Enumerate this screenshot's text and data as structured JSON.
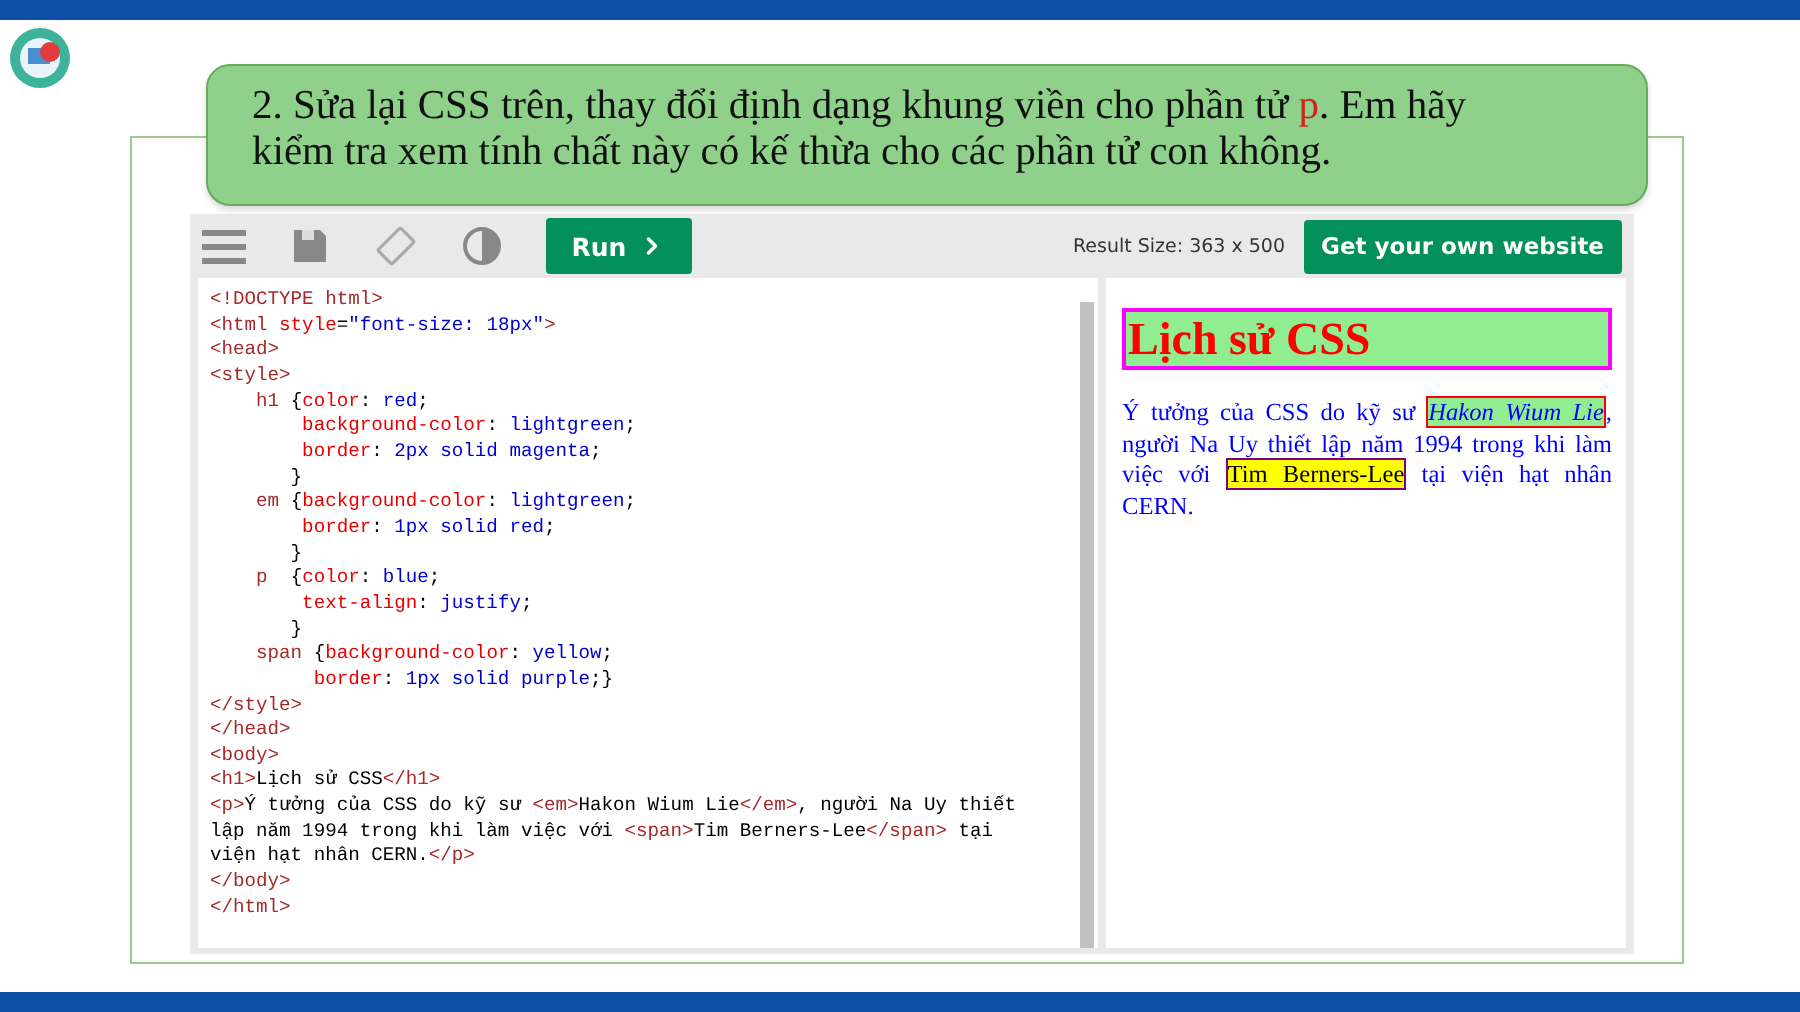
{
  "prompt": [
    {
      "kind": "text",
      "text": "2. Sửa lại CSS trên, thay đổi định dạng khung viền cho phần tử "
    },
    {
      "kind": "highlight",
      "text": "p"
    },
    {
      "kind": "text",
      "text": ". Em hãy kiểm tra xem tính chất này có kế thừa cho các phần tử con không."
    }
  ],
  "editor": {
    "run_label": "Run",
    "result_size": "Result Size: 363 x 500",
    "cta": "Get your own website",
    "code": [
      [
        {
          "kind": "tag",
          "text": "<!DOCTYPE html>"
        }
      ],
      [
        {
          "kind": "tag",
          "text": "<html "
        },
        {
          "kind": "attr",
          "text": "style"
        },
        {
          "kind": "plain",
          "text": "="
        },
        {
          "kind": "val",
          "text": "\"font-size: 18px\""
        },
        {
          "kind": "tag",
          "text": ">"
        }
      ],
      [
        {
          "kind": "tag",
          "text": "<head>"
        }
      ],
      [
        {
          "kind": "tag",
          "text": "<style>"
        }
      ],
      [
        {
          "kind": "sel",
          "text": "    h1 "
        },
        {
          "kind": "plain",
          "text": "{"
        },
        {
          "kind": "prop",
          "text": "color"
        },
        {
          "kind": "plain",
          "text": ": "
        },
        {
          "kind": "val",
          "text": "red"
        },
        {
          "kind": "plain",
          "text": ";"
        }
      ],
      [
        {
          "kind": "prop",
          "text": "        background-color"
        },
        {
          "kind": "plain",
          "text": ": "
        },
        {
          "kind": "val",
          "text": "lightgreen"
        },
        {
          "kind": "plain",
          "text": ";"
        }
      ],
      [
        {
          "kind": "prop",
          "text": "        border"
        },
        {
          "kind": "plain",
          "text": ": "
        },
        {
          "kind": "val",
          "text": "2px solid magenta"
        },
        {
          "kind": "plain",
          "text": ";"
        }
      ],
      [
        {
          "kind": "plain",
          "text": "       }"
        }
      ],
      [
        {
          "kind": "sel",
          "text": "    em "
        },
        {
          "kind": "plain",
          "text": "{"
        },
        {
          "kind": "prop",
          "text": "background-color"
        },
        {
          "kind": "plain",
          "text": ": "
        },
        {
          "kind": "val",
          "text": "lightgreen"
        },
        {
          "kind": "plain",
          "text": ";"
        }
      ],
      [
        {
          "kind": "prop",
          "text": "        border"
        },
        {
          "kind": "plain",
          "text": ": "
        },
        {
          "kind": "val",
          "text": "1px solid red"
        },
        {
          "kind": "plain",
          "text": ";"
        }
      ],
      [
        {
          "kind": "plain",
          "text": "       }"
        }
      ],
      [
        {
          "kind": "sel",
          "text": "    p  "
        },
        {
          "kind": "plain",
          "text": "{"
        },
        {
          "kind": "prop",
          "text": "color"
        },
        {
          "kind": "plain",
          "text": ": "
        },
        {
          "kind": "val",
          "text": "blue"
        },
        {
          "kind": "plain",
          "text": ";"
        }
      ],
      [
        {
          "kind": "prop",
          "text": "        text-align"
        },
        {
          "kind": "plain",
          "text": ": "
        },
        {
          "kind": "val",
          "text": "justify"
        },
        {
          "kind": "plain",
          "text": ";"
        }
      ],
      [
        {
          "kind": "plain",
          "text": "       }"
        }
      ],
      [
        {
          "kind": "sel",
          "text": "    span "
        },
        {
          "kind": "plain",
          "text": "{"
        },
        {
          "kind": "prop",
          "text": "background-color"
        },
        {
          "kind": "plain",
          "text": ": "
        },
        {
          "kind": "val",
          "text": "yellow"
        },
        {
          "kind": "plain",
          "text": ";"
        }
      ],
      [
        {
          "kind": "prop",
          "text": "         border"
        },
        {
          "kind": "plain",
          "text": ": "
        },
        {
          "kind": "val",
          "text": "1px solid purple"
        },
        {
          "kind": "plain",
          "text": ";}"
        }
      ],
      [
        {
          "kind": "tag",
          "text": "</style>"
        }
      ],
      [
        {
          "kind": "tag",
          "text": "</head>"
        }
      ],
      [
        {
          "kind": "tag",
          "text": "<body>"
        }
      ],
      [
        {
          "kind": "tag",
          "text": "<h1>"
        },
        {
          "kind": "plain",
          "text": "Lịch sử CSS"
        },
        {
          "kind": "tag",
          "text": "</h1>"
        }
      ],
      [
        {
          "kind": "tag",
          "text": "<p>"
        },
        {
          "kind": "plain",
          "text": "Ý tưởng của CSS do kỹ sư "
        },
        {
          "kind": "tag",
          "text": "<em>"
        },
        {
          "kind": "plain",
          "text": "Hakon Wium Lie"
        },
        {
          "kind": "tag",
          "text": "</em>"
        },
        {
          "kind": "plain",
          "text": ", người Na Uy thiết"
        }
      ],
      [
        {
          "kind": "plain",
          "text": "lập năm 1994 trong khi làm việc với "
        },
        {
          "kind": "tag",
          "text": "<span>"
        },
        {
          "kind": "plain",
          "text": "Tim Berners-Lee"
        },
        {
          "kind": "tag",
          "text": "</span>"
        },
        {
          "kind": "plain",
          "text": " tại"
        }
      ],
      [
        {
          "kind": "plain",
          "text": "viện hạt nhân CERN."
        },
        {
          "kind": "tag",
          "text": "</p>"
        }
      ],
      [
        {
          "kind": "tag",
          "text": "</body>"
        }
      ],
      [
        {
          "kind": "tag",
          "text": "</html>"
        }
      ]
    ]
  },
  "result": {
    "heading": "Lịch sử CSS",
    "paragraph": [
      {
        "kind": "text",
        "text": "Ý tưởng của CSS do kỹ sư "
      },
      {
        "kind": "em",
        "text": "Hakon Wium Lie"
      },
      {
        "kind": "text",
        "text": ", người Na Uy thiết lập năm 1994 trong khi làm việc với "
      },
      {
        "kind": "span",
        "text": "Tim Berners-Lee"
      },
      {
        "kind": "text",
        "text": " tại viện hạt nhân CERN."
      }
    ]
  }
}
